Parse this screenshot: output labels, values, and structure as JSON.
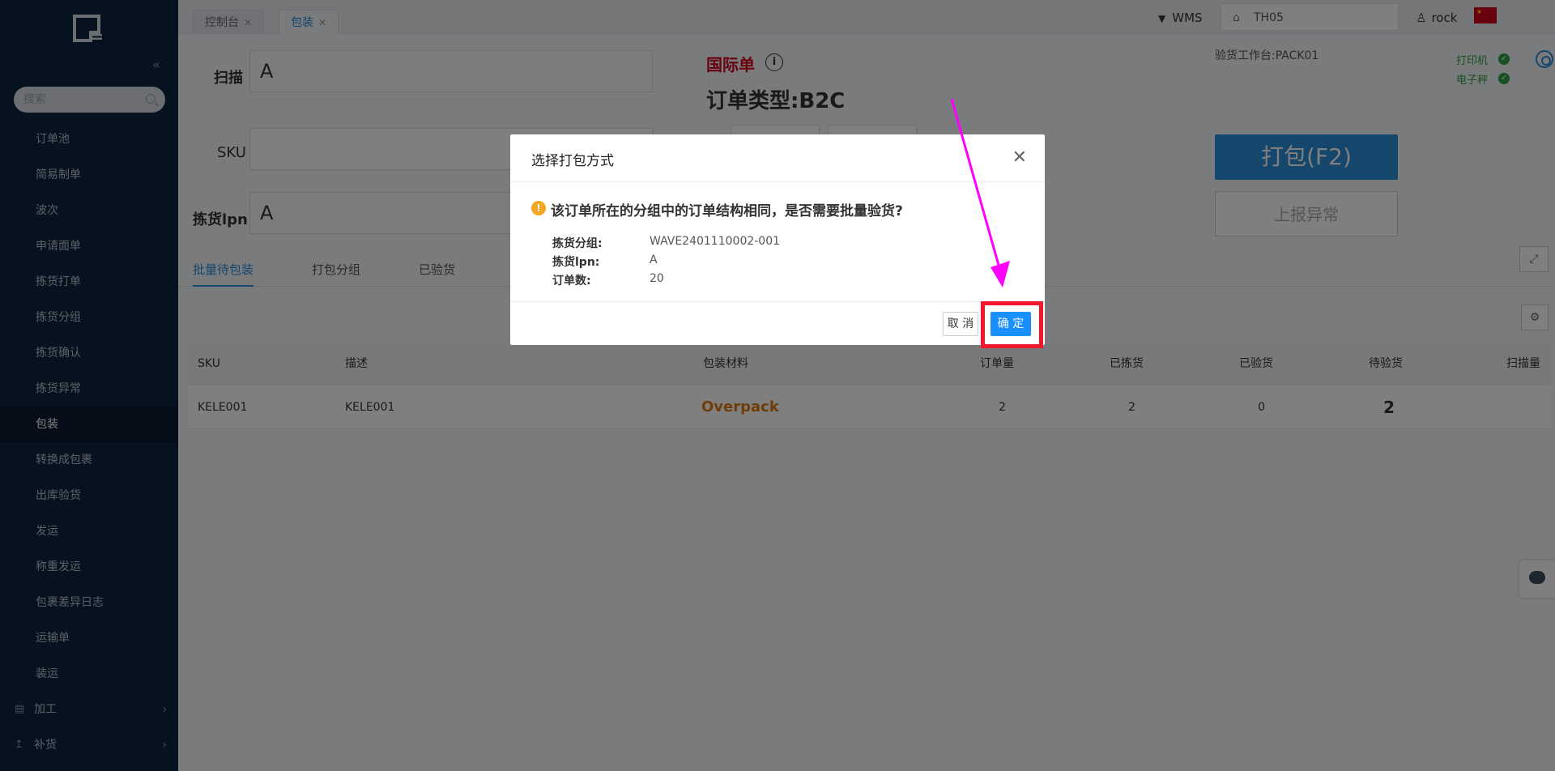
{
  "sidebar": {
    "search_placeholder": "搜索",
    "collapse_icon": "double-chevron-left-icon",
    "items": [
      {
        "label": "订单池"
      },
      {
        "label": "简易制单"
      },
      {
        "label": "波次"
      },
      {
        "label": "申请面单"
      },
      {
        "label": "拣货打单"
      },
      {
        "label": "拣货分组"
      },
      {
        "label": "拣货确认"
      },
      {
        "label": "拣货异常"
      },
      {
        "label": "包装",
        "active": true
      },
      {
        "label": "转换成包裹"
      },
      {
        "label": "出库验货"
      },
      {
        "label": "发运"
      },
      {
        "label": "称重发运"
      },
      {
        "label": "包裹差异日志"
      },
      {
        "label": "运输单"
      },
      {
        "label": "装运"
      }
    ],
    "groups": [
      {
        "label": "加工",
        "icon": "building-icon"
      },
      {
        "label": "补货",
        "icon": "upload-icon"
      }
    ]
  },
  "topbar": {
    "tabs": [
      {
        "label": "控制台"
      },
      {
        "label": "包装",
        "active": true
      }
    ],
    "system": "WMS",
    "warehouse": "TH05",
    "user": "rock"
  },
  "pack": {
    "scan_label": "扫描",
    "scan_value": "A",
    "sku_label": "SKU",
    "sku_value": "",
    "lpn_label": "拣货lpn",
    "lpn_value": "A",
    "international": "国际单",
    "order_type": "订单类型:B2C",
    "station": "验货工作台:PACK01",
    "printer": "打印机",
    "scale": "电子秤",
    "pack_btn": "打包(F2)",
    "report_btn": "上报异常"
  },
  "subtabs": [
    "批量待包装",
    "打包分组",
    "已验货"
  ],
  "table": {
    "headers": [
      "SKU",
      "描述",
      "包装材料",
      "订单量",
      "已拣货",
      "已验货",
      "待验货",
      "扫描量"
    ],
    "rows": [
      {
        "sku": "KELE001",
        "desc": "KELE001",
        "material": "Overpack",
        "order_qty": "2",
        "picked": "2",
        "checked": "0",
        "pending": "2",
        "scanned": ""
      }
    ]
  },
  "modal": {
    "title": "选择打包方式",
    "question": "该订单所在的分组中的订单结构相同，是否需要批量验货?",
    "fields": [
      {
        "key": "拣货分组:",
        "value": "WAVE2401110002-001"
      },
      {
        "key": "拣货lpn:",
        "value": "A"
      },
      {
        "key": "订单数:",
        "value": "20"
      }
    ],
    "cancel": "取 消",
    "ok": "确 定"
  },
  "colors": {
    "sidebar_bg": "#0f2540",
    "primary": "#2b8cd8",
    "highlight": "#f0182a",
    "arrow": "#ff00ff",
    "warning": "#f5a623",
    "overpack": "#e07a10"
  }
}
